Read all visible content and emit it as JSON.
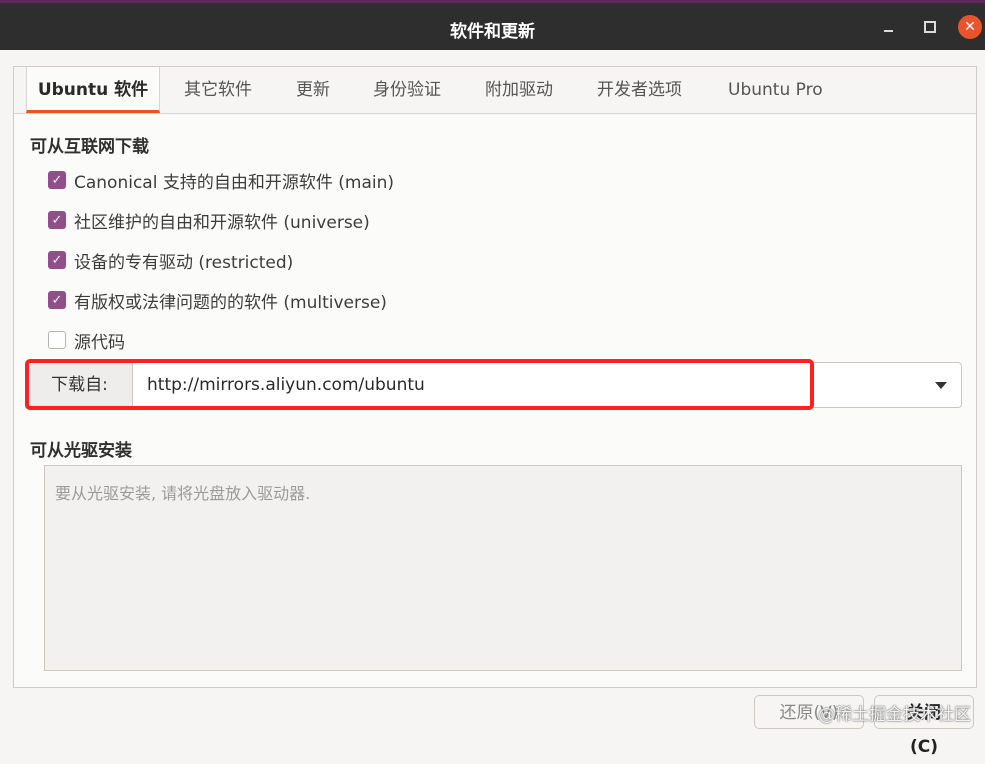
{
  "window": {
    "title": "软件和更新",
    "controls": {
      "minimize_icon": "minimize-icon",
      "maximize_icon": "maximize-icon",
      "close_glyph": "✕"
    }
  },
  "tabs": [
    {
      "label": "Ubuntu 软件",
      "active": true
    },
    {
      "label": "其它软件",
      "active": false
    },
    {
      "label": "更新",
      "active": false
    },
    {
      "label": "身份验证",
      "active": false
    },
    {
      "label": "附加驱动",
      "active": false
    },
    {
      "label": "开发者选项",
      "active": false
    },
    {
      "label": "Ubuntu Pro",
      "active": false
    }
  ],
  "internet": {
    "heading": "可从互联网下载",
    "options": [
      {
        "label": "Canonical 支持的自由和开源软件 (main)",
        "checked": true
      },
      {
        "label": "社区维护的自由和开源软件 (universe)",
        "checked": true
      },
      {
        "label": "设备的专有驱动 (restricted)",
        "checked": true
      },
      {
        "label": "有版权或法律问题的的软件 (multiverse)",
        "checked": true
      },
      {
        "label": "源代码",
        "checked": false
      }
    ],
    "download_from": {
      "label": "下载自:",
      "value": "http://mirrors.aliyun.com/ubuntu"
    }
  },
  "cdrom": {
    "heading": "可从光驱安装",
    "placeholder": "要从光驱安装, 请将光盘放入驱动器."
  },
  "buttons": {
    "revert": "还原(V)",
    "close": "关闭(C)"
  },
  "watermark": "@稀土掘金技术社区",
  "colors": {
    "titlebar": "#2e2e2e",
    "accent": "#e95420",
    "checkbox": "#924d8b",
    "highlight_box": "#ff2020"
  }
}
